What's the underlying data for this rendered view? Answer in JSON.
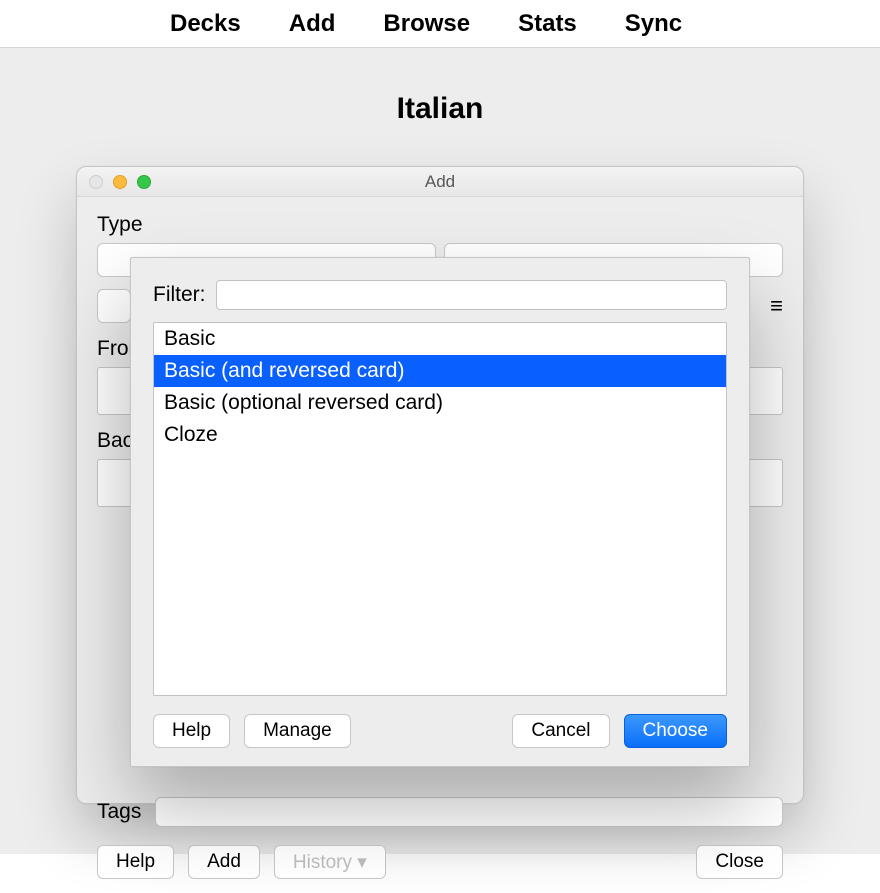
{
  "menu": {
    "items": [
      "Decks",
      "Add",
      "Browse",
      "Stats",
      "Sync"
    ]
  },
  "deckTitle": "Italian",
  "addWindow": {
    "title": "Add",
    "typeLabel": "Type",
    "frontLabel": "Front",
    "backLabel": "Back",
    "tagsLabel": "Tags",
    "help": "Help",
    "add": "Add",
    "history": "History ▾",
    "close": "Close",
    "hamburger": "≡"
  },
  "chooser": {
    "filterLabel": "Filter:",
    "filterValue": "",
    "options": [
      {
        "label": "Basic",
        "selected": false
      },
      {
        "label": "Basic (and reversed card)",
        "selected": true
      },
      {
        "label": "Basic (optional reversed card)",
        "selected": false
      },
      {
        "label": "Cloze",
        "selected": false
      }
    ],
    "help": "Help",
    "manage": "Manage",
    "cancel": "Cancel",
    "choose": "Choose"
  }
}
